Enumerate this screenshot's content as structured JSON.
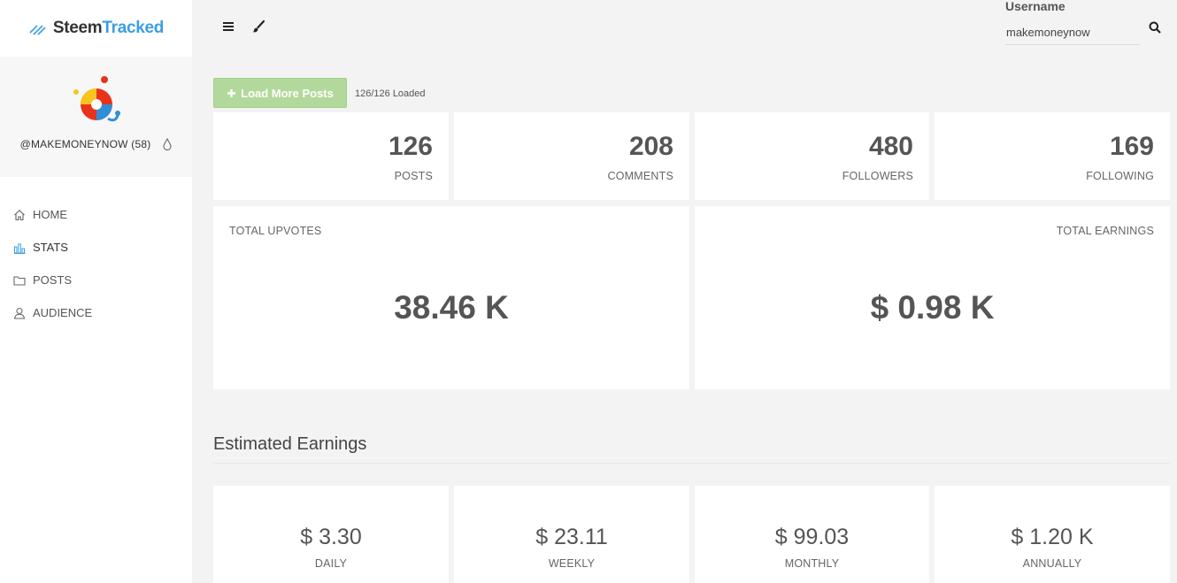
{
  "brand": {
    "part1": "Steem",
    "part2": "Tracked",
    "colors": {
      "dark": "#333333",
      "accent": "#3a9ee4"
    }
  },
  "profile": {
    "handle": "@MAKEMONEYNOW (58)"
  },
  "nav": [
    {
      "label": "HOME",
      "icon": "home-icon"
    },
    {
      "label": "STATS",
      "icon": "bar-chart-icon"
    },
    {
      "label": "POSTS",
      "icon": "folder-icon"
    },
    {
      "label": "AUDIENCE",
      "icon": "user-icon"
    }
  ],
  "topbar": {
    "menu_icon": "hamburger-menu-icon",
    "theme_icon": "paintbrush-icon"
  },
  "search": {
    "label": "Username",
    "value": "makemoneynow",
    "icon": "search-icon"
  },
  "load": {
    "button_label": "Load More Posts",
    "status": "126/126 Loaded",
    "button_color": "#b2d99b"
  },
  "stats": [
    {
      "value": "126",
      "label": "POSTS"
    },
    {
      "value": "208",
      "label": "COMMENTS"
    },
    {
      "value": "480",
      "label": "FOLLOWERS"
    },
    {
      "value": "169",
      "label": "FOLLOWING"
    }
  ],
  "totals": {
    "upvotes": {
      "label": "TOTAL UPVOTES",
      "value": "38.46 K"
    },
    "earnings": {
      "label": "TOTAL EARNINGS",
      "value": "$ 0.98 K"
    }
  },
  "estimated": {
    "title": "Estimated Earnings",
    "items": [
      {
        "value": "$ 3.30",
        "label": "DAILY"
      },
      {
        "value": "$ 23.11",
        "label": "WEEKLY"
      },
      {
        "value": "$ 99.03",
        "label": "MONTHLY"
      },
      {
        "value": "$ 1.20 K",
        "label": "ANNUALLY"
      }
    ]
  }
}
